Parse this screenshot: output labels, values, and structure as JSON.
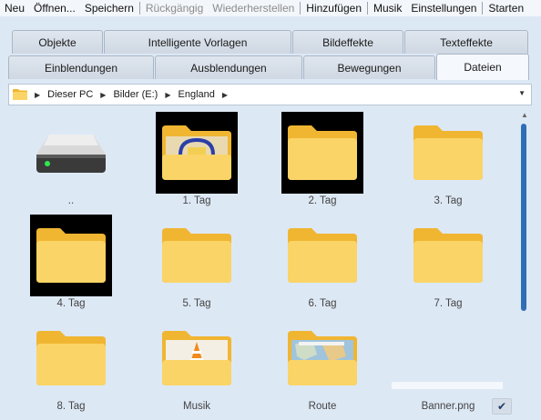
{
  "menu": {
    "items": [
      {
        "label": "Neu",
        "disabled": false
      },
      {
        "label": "Öffnen...",
        "disabled": false
      },
      {
        "label": "Speichern",
        "disabled": false
      },
      {
        "label": "Rückgängig",
        "disabled": true
      },
      {
        "label": "Wiederherstellen",
        "disabled": true
      },
      {
        "label": "Hinzufügen",
        "disabled": false
      },
      {
        "label": "Musik",
        "disabled": false
      },
      {
        "label": "Einstellungen",
        "disabled": false
      },
      {
        "label": "Starten",
        "disabled": false
      }
    ]
  },
  "tabs": {
    "row1": [
      "Objekte",
      "Intelligente Vorlagen",
      "Bildeffekte",
      "Texteffekte"
    ],
    "row2": [
      "Einblendungen",
      "Ausblendungen",
      "Bewegungen",
      "Dateien"
    ],
    "active": "Dateien"
  },
  "address": {
    "crumbs": [
      "Dieser PC",
      "Bilder (E:)",
      "England"
    ]
  },
  "files": [
    {
      "name": "..",
      "kind": "drive"
    },
    {
      "name": "1. Tag",
      "kind": "folder-photo",
      "selected": true
    },
    {
      "name": "2. Tag",
      "kind": "folder",
      "selected": true
    },
    {
      "name": "3. Tag",
      "kind": "folder"
    },
    {
      "name": "4. Tag",
      "kind": "folder",
      "selected": true
    },
    {
      "name": "5. Tag",
      "kind": "folder"
    },
    {
      "name": "6. Tag",
      "kind": "folder"
    },
    {
      "name": "7. Tag",
      "kind": "folder"
    },
    {
      "name": "8. Tag",
      "kind": "folder"
    },
    {
      "name": "Musik",
      "kind": "folder-vlc"
    },
    {
      "name": "Route",
      "kind": "folder-map"
    },
    {
      "name": "Banner.png",
      "kind": "image"
    }
  ],
  "colors": {
    "background": "#dde8f5",
    "scroll_thumb": "#2f6db5",
    "folder": "#f8c94a"
  }
}
